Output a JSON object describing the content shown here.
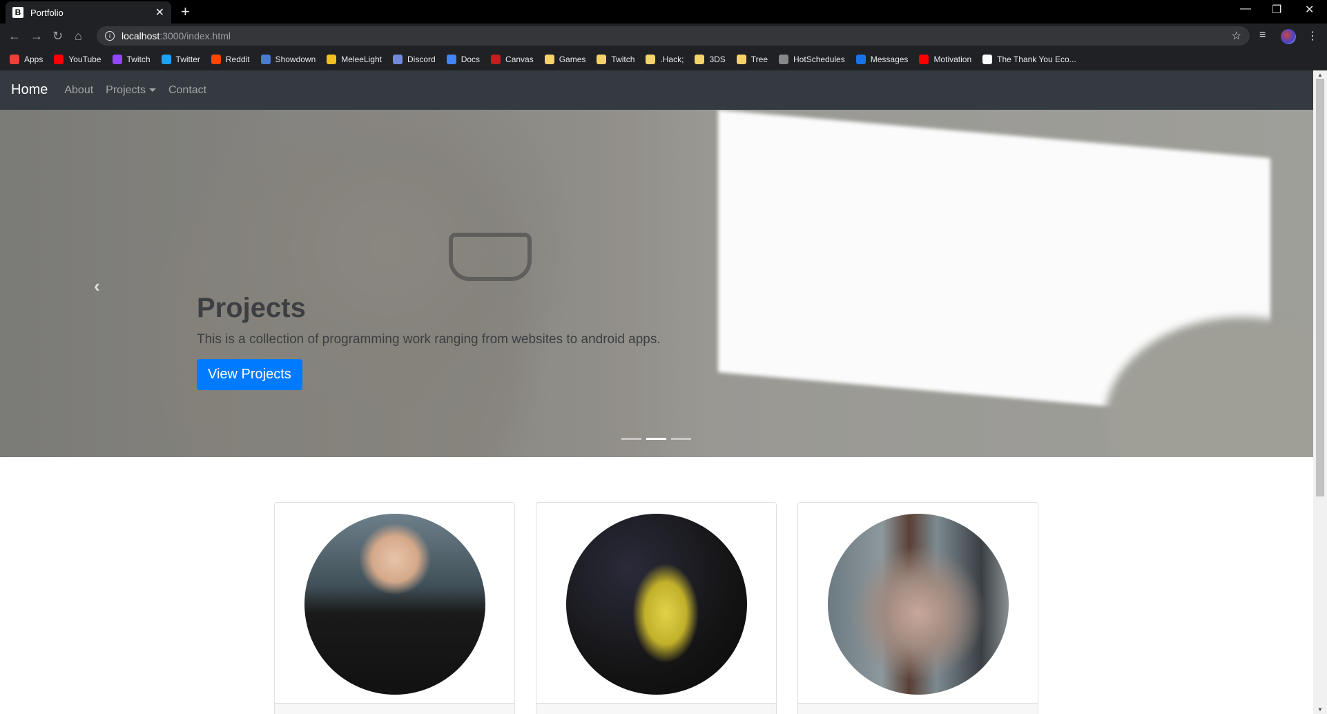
{
  "browser": {
    "tab_title": "Portfolio",
    "tab_favicon": "B",
    "url_host": "localhost",
    "url_path": ":3000/index.html",
    "bookmarks": [
      {
        "label": "Apps",
        "color": "#ea4335"
      },
      {
        "label": "YouTube",
        "color": "#ff0000"
      },
      {
        "label": "Twitch",
        "color": "#9146ff"
      },
      {
        "label": "Twitter",
        "color": "#1da1f2"
      },
      {
        "label": "Reddit",
        "color": "#ff4500"
      },
      {
        "label": "Showdown",
        "color": "#4a7bd0"
      },
      {
        "label": "MeleeLight",
        "color": "#f0c020"
      },
      {
        "label": "Discord",
        "color": "#7289da"
      },
      {
        "label": "Docs",
        "color": "#4285f4"
      },
      {
        "label": "Canvas",
        "color": "#c41e1e"
      },
      {
        "label": "Games",
        "color": "#f5d36b"
      },
      {
        "label": "Twitch",
        "color": "#f5d36b"
      },
      {
        "label": ".Hack;",
        "color": "#f5d36b"
      },
      {
        "label": "3DS",
        "color": "#f5d36b"
      },
      {
        "label": "Tree",
        "color": "#f5d36b"
      },
      {
        "label": "HotSchedules",
        "color": "#888888"
      },
      {
        "label": "Messages",
        "color": "#1a73e8"
      },
      {
        "label": "Motivation",
        "color": "#ff0000"
      },
      {
        "label": "The Thank You Eco...",
        "color": "#ffffff"
      }
    ]
  },
  "navbar": {
    "brand": "Home",
    "links": [
      "About",
      "Projects",
      "Contact"
    ]
  },
  "hero": {
    "title": "Projects",
    "text": "This is a collection of programming work ranging from websites to android apps.",
    "button": "View Projects",
    "prev_icon": "chevron-left-icon",
    "indicators": 3,
    "active_indicator": 2
  },
  "cards": [
    {
      "image": "portrait-smiling-person"
    },
    {
      "image": "person-jumping-night"
    },
    {
      "image": "portrait-reflection"
    }
  ]
}
